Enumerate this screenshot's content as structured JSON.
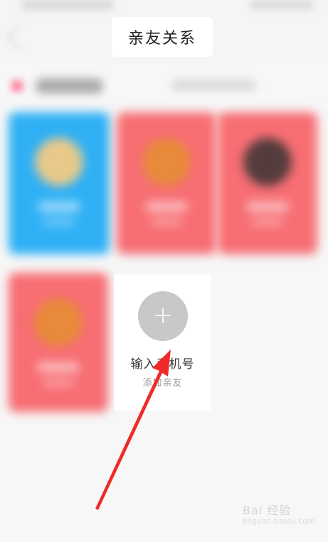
{
  "header": {
    "title": "亲友关系"
  },
  "cards": [
    {
      "color": "#2fb0f5",
      "avatar_color": "#e8c98a"
    },
    {
      "color": "#f76e73",
      "avatar_color": "#e88a3a"
    },
    {
      "color": "#f76e73",
      "avatar_color": "#553c3c"
    },
    {
      "color": "#f76e73",
      "avatar_color": "#e88a3a"
    }
  ],
  "add_card": {
    "title": "输入手机号",
    "subtitle": "添加亲友",
    "icon": "plus-icon"
  },
  "annotation": {
    "arrow_color": "#f02a2a"
  },
  "watermark": {
    "text": "Bai 经验",
    "sub": "jingyan.baidu.com"
  }
}
